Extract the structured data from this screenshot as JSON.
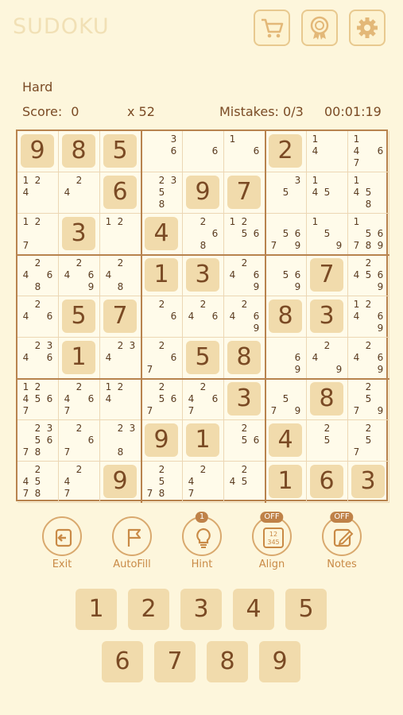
{
  "app": {
    "title": "SUDOKU"
  },
  "header": {
    "difficulty": "Hard",
    "score_label": "Score:",
    "score": "0",
    "multiplier": "x 52",
    "mistakes_label": "Mistakes:",
    "mistakes": "0/3",
    "timer": "00:01:19"
  },
  "toolbar": {
    "icons": [
      "cart-icon",
      "award-icon",
      "gear-icon"
    ]
  },
  "board": {
    "cells": [
      [
        {
          "v": 9
        },
        {
          "v": 8
        },
        {
          "v": 5
        },
        {
          "n": [
            3,
            6
          ]
        },
        {
          "n": [
            6
          ]
        },
        {
          "n": [
            1,
            6
          ]
        },
        {
          "v": 2
        },
        {
          "n": [
            1,
            4
          ]
        },
        {
          "n": [
            1,
            4,
            6,
            7
          ]
        }
      ],
      [
        {
          "n": [
            1,
            2,
            4
          ]
        },
        {
          "n": [
            2,
            4
          ]
        },
        {
          "v": 6
        },
        {
          "n": [
            2,
            3,
            5,
            8
          ]
        },
        {
          "v": 9
        },
        {
          "v": 7
        },
        {
          "n": [
            3,
            5
          ]
        },
        {
          "n": [
            1,
            4,
            5
          ]
        },
        {
          "n": [
            1,
            4,
            5,
            8
          ]
        }
      ],
      [
        {
          "n": [
            1,
            2,
            7
          ]
        },
        {
          "v": 3
        },
        {
          "n": [
            1,
            2
          ]
        },
        {
          "v": 4
        },
        {
          "n": [
            2,
            6,
            8
          ]
        },
        {
          "n": [
            1,
            2,
            5,
            6
          ]
        },
        {
          "n": [
            5,
            6,
            7,
            9
          ]
        },
        {
          "n": [
            1,
            5,
            9
          ]
        },
        {
          "n": [
            1,
            5,
            6,
            7,
            8,
            9
          ]
        }
      ],
      [
        {
          "n": [
            2,
            4,
            6,
            8
          ]
        },
        {
          "n": [
            2,
            4,
            6,
            9
          ]
        },
        {
          "n": [
            2,
            4,
            8
          ]
        },
        {
          "v": 1
        },
        {
          "v": 3
        },
        {
          "n": [
            2,
            4,
            6,
            9
          ]
        },
        {
          "n": [
            5,
            6,
            9
          ]
        },
        {
          "v": 7
        },
        {
          "n": [
            2,
            4,
            5,
            6,
            9
          ]
        }
      ],
      [
        {
          "n": [
            2,
            4,
            6
          ]
        },
        {
          "v": 5
        },
        {
          "v": 7
        },
        {
          "n": [
            2,
            6
          ]
        },
        {
          "n": [
            2,
            4,
            6
          ]
        },
        {
          "n": [
            2,
            4,
            6,
            9
          ]
        },
        {
          "v": 8
        },
        {
          "v": 3
        },
        {
          "n": [
            1,
            2,
            4,
            6,
            9
          ]
        }
      ],
      [
        {
          "n": [
            2,
            3,
            4,
            6
          ]
        },
        {
          "v": 1
        },
        {
          "n": [
            2,
            3,
            4
          ]
        },
        {
          "n": [
            2,
            6,
            7
          ]
        },
        {
          "v": 5
        },
        {
          "v": 8
        },
        {
          "n": [
            6,
            9
          ]
        },
        {
          "n": [
            2,
            4,
            9
          ]
        },
        {
          "n": [
            2,
            4,
            6,
            9
          ]
        }
      ],
      [
        {
          "n": [
            1,
            2,
            4,
            5,
            6,
            7
          ]
        },
        {
          "n": [
            2,
            4,
            6,
            7
          ]
        },
        {
          "n": [
            1,
            2,
            4
          ]
        },
        {
          "n": [
            2,
            5,
            6,
            7
          ]
        },
        {
          "n": [
            2,
            4,
            6,
            7
          ]
        },
        {
          "v": 3
        },
        {
          "n": [
            5,
            7,
            9
          ]
        },
        {
          "v": 8
        },
        {
          "n": [
            2,
            5,
            7,
            9
          ]
        }
      ],
      [
        {
          "n": [
            2,
            3,
            5,
            6,
            7,
            8
          ]
        },
        {
          "n": [
            2,
            6,
            7
          ]
        },
        {
          "n": [
            2,
            3,
            8
          ]
        },
        {
          "v": 9
        },
        {
          "v": 1
        },
        {
          "n": [
            2,
            5,
            6
          ]
        },
        {
          "v": 4
        },
        {
          "n": [
            2,
            5
          ]
        },
        {
          "n": [
            2,
            5,
            7
          ]
        }
      ],
      [
        {
          "n": [
            2,
            4,
            5,
            7,
            8
          ]
        },
        {
          "n": [
            2,
            4,
            7
          ]
        },
        {
          "v": 9
        },
        {
          "n": [
            2,
            5,
            7,
            8
          ]
        },
        {
          "n": [
            2,
            4,
            7
          ]
        },
        {
          "n": [
            2,
            4,
            5
          ]
        },
        {
          "v": 1
        },
        {
          "v": 6
        },
        {
          "v": 3
        }
      ]
    ]
  },
  "actions": [
    {
      "label": "Exit",
      "icon": "exit-icon",
      "badge": ""
    },
    {
      "label": "AutoFill",
      "icon": "flag-icon",
      "badge": ""
    },
    {
      "label": "Hint",
      "icon": "lightbulb-icon",
      "badge": "1"
    },
    {
      "label": "Align",
      "icon": "align-numbers-icon",
      "badge": "OFF",
      "icon_text": [
        "12",
        "345"
      ]
    },
    {
      "label": "Notes",
      "icon": "pencil-icon",
      "badge": "OFF"
    }
  ],
  "numpad": [
    "1",
    "2",
    "3",
    "4",
    "5",
    "6",
    "7",
    "8",
    "9"
  ]
}
